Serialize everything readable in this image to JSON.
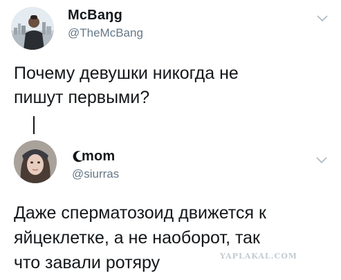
{
  "tweet1": {
    "name": "McBaŋg",
    "handle": "@TheMcBang",
    "text_line1": "Почему девушки никогда не",
    "text_line2": "пишут первыми?"
  },
  "tweet2": {
    "name": "mom",
    "name_prefix_glyph": "moon-icon",
    "handle": "@siurras",
    "text_line1": "Даже сперматозоид движется к",
    "text_line2": "яйцеклетке, а не наоборот, так",
    "text_line3": "что завали ротяру"
  },
  "watermark": "YAPLAKAL.COM",
  "colors": {
    "text": "#14171a",
    "handle": "#657786",
    "chevron": "#aab8c2",
    "watermark": "#c0cbd2"
  }
}
